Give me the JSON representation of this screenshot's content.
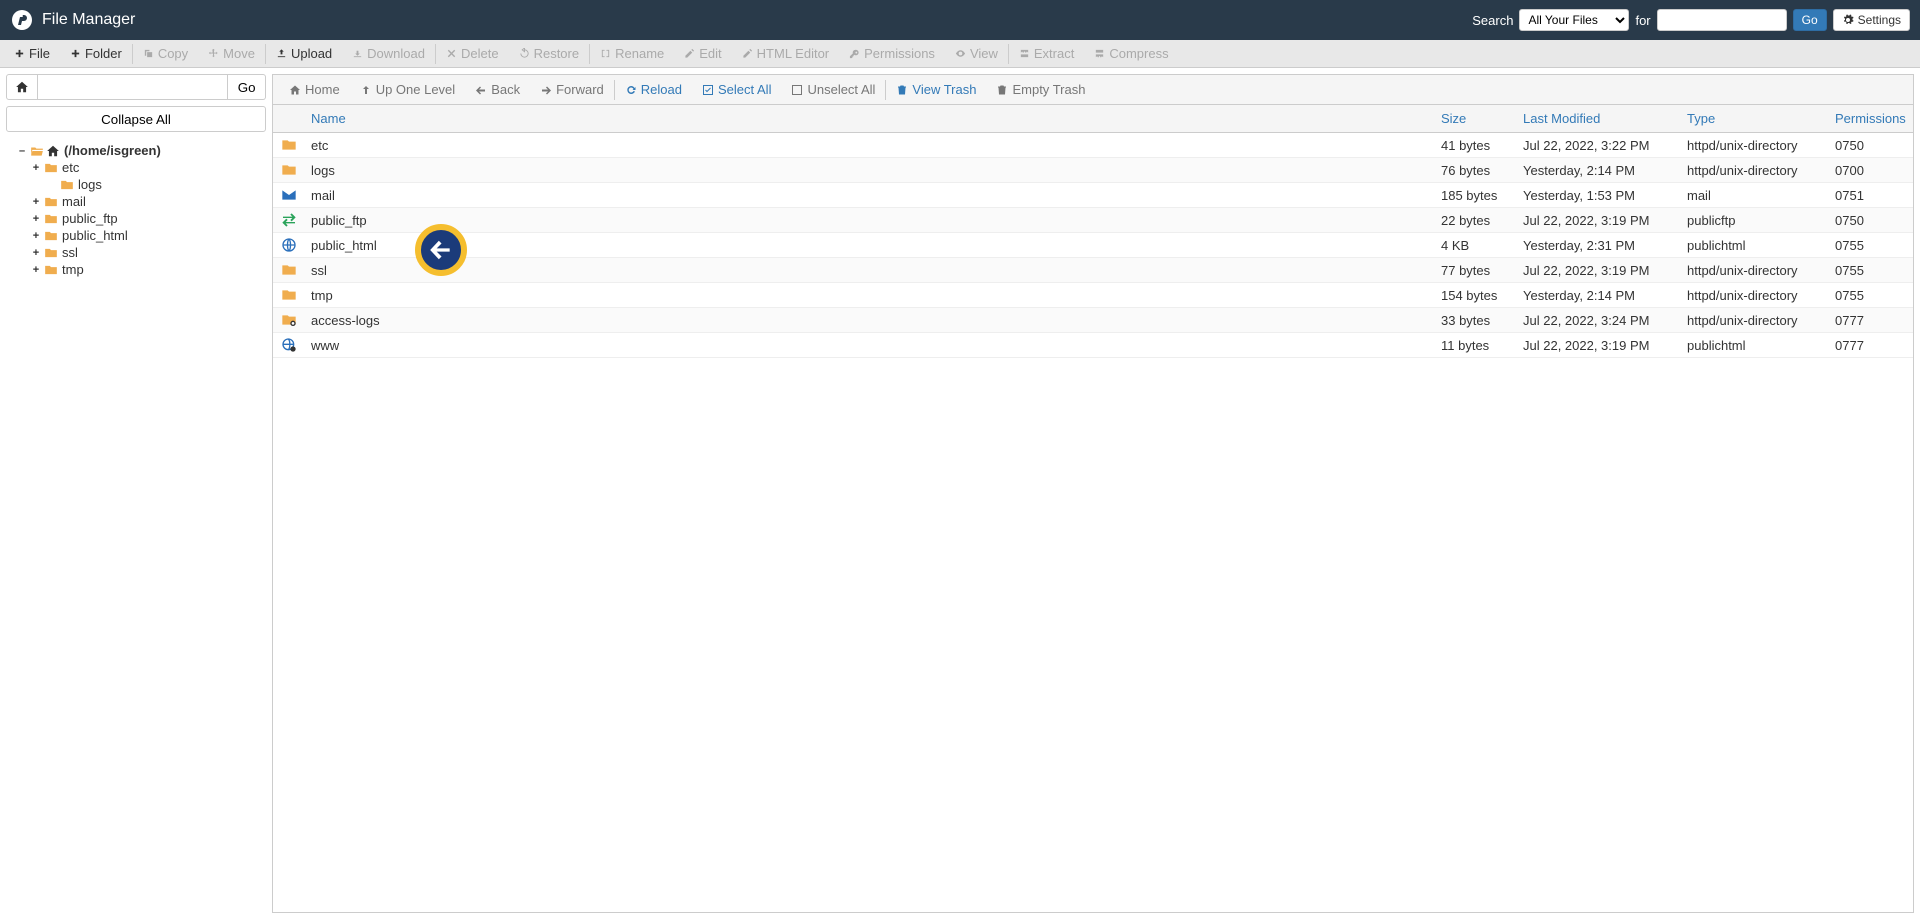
{
  "header": {
    "title": "File Manager",
    "search_label": "Search",
    "search_select": "All Your Files",
    "for_label": "for",
    "go_label": "Go",
    "settings_label": "Settings"
  },
  "toolbar": {
    "file": "File",
    "folder": "Folder",
    "copy": "Copy",
    "move": "Move",
    "upload": "Upload",
    "download": "Download",
    "delete": "Delete",
    "restore": "Restore",
    "rename": "Rename",
    "edit": "Edit",
    "html_editor": "HTML Editor",
    "permissions": "Permissions",
    "view": "View",
    "extract": "Extract",
    "compress": "Compress"
  },
  "left": {
    "go": "Go",
    "collapse": "Collapse All",
    "root": "(/home/isgreen)",
    "tree": [
      {
        "label": "etc",
        "level": 1,
        "expander": "+"
      },
      {
        "label": "logs",
        "level": 2,
        "expander": ""
      },
      {
        "label": "mail",
        "level": 1,
        "expander": "+"
      },
      {
        "label": "public_ftp",
        "level": 1,
        "expander": "+"
      },
      {
        "label": "public_html",
        "level": 1,
        "expander": "+"
      },
      {
        "label": "ssl",
        "level": 1,
        "expander": "+"
      },
      {
        "label": "tmp",
        "level": 1,
        "expander": "+"
      }
    ]
  },
  "sec_toolbar": {
    "home": "Home",
    "up": "Up One Level",
    "back": "Back",
    "forward": "Forward",
    "reload": "Reload",
    "select_all": "Select All",
    "unselect_all": "Unselect All",
    "view_trash": "View Trash",
    "empty_trash": "Empty Trash"
  },
  "columns": {
    "name": "Name",
    "size": "Size",
    "modified": "Last Modified",
    "type": "Type",
    "permissions": "Permissions"
  },
  "rows": [
    {
      "icon": "folder",
      "name": "etc",
      "size": "41 bytes",
      "modified": "Jul 22, 2022, 3:22 PM",
      "type": "httpd/unix-directory",
      "perm": "0750"
    },
    {
      "icon": "folder",
      "name": "logs",
      "size": "76 bytes",
      "modified": "Yesterday, 2:14 PM",
      "type": "httpd/unix-directory",
      "perm": "0700"
    },
    {
      "icon": "mail",
      "name": "mail",
      "size": "185 bytes",
      "modified": "Yesterday, 1:53 PM",
      "type": "mail",
      "perm": "0751"
    },
    {
      "icon": "ftp",
      "name": "public_ftp",
      "size": "22 bytes",
      "modified": "Jul 22, 2022, 3:19 PM",
      "type": "publicftp",
      "perm": "0750"
    },
    {
      "icon": "web",
      "name": "public_html",
      "size": "4 KB",
      "modified": "Yesterday, 2:31 PM",
      "type": "publichtml",
      "perm": "0755"
    },
    {
      "icon": "folder",
      "name": "ssl",
      "size": "77 bytes",
      "modified": "Jul 22, 2022, 3:19 PM",
      "type": "httpd/unix-directory",
      "perm": "0755"
    },
    {
      "icon": "folder",
      "name": "tmp",
      "size": "154 bytes",
      "modified": "Yesterday, 2:14 PM",
      "type": "httpd/unix-directory",
      "perm": "0755"
    },
    {
      "icon": "link",
      "name": "access-logs",
      "size": "33 bytes",
      "modified": "Jul 22, 2022, 3:24 PM",
      "type": "httpd/unix-directory",
      "perm": "0777"
    },
    {
      "icon": "weblink",
      "name": "www",
      "size": "11 bytes",
      "modified": "Jul 22, 2022, 3:19 PM",
      "type": "publichtml",
      "perm": "0777"
    }
  ]
}
